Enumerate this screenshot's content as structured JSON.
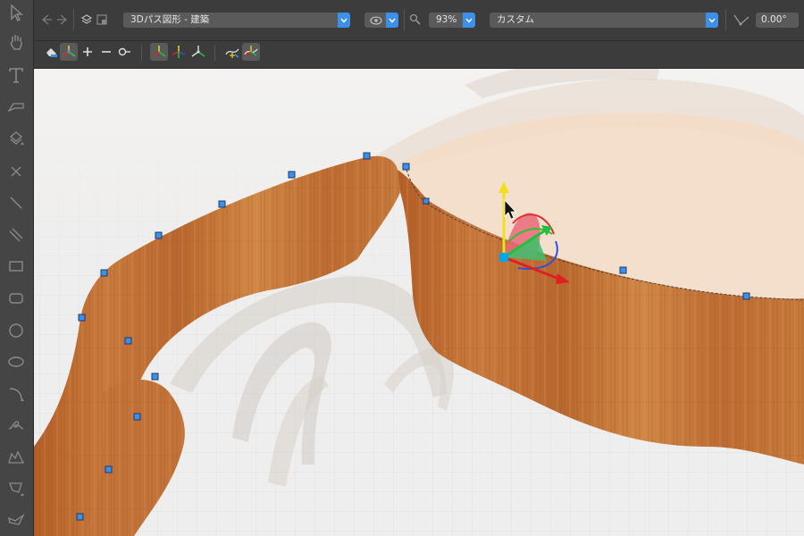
{
  "toolbar": {
    "shape_select": {
      "value": "3Dパス図形 - 建築"
    },
    "view_select": {
      "value": ""
    },
    "zoom": {
      "value": "93%"
    },
    "material_select": {
      "value": "カスタム"
    },
    "angle": {
      "value": "0.00°"
    }
  },
  "colors": {
    "accent": "#3d8fe8",
    "handle": "#3d8fe8",
    "wood": "#c8743a",
    "axis_x": "#e02020",
    "axis_y": "#f0e020",
    "axis_z": "#20c040",
    "rotate_ring_red": "#e03030",
    "rotate_ring_green": "#30c030",
    "rotate_ring_blue": "#3050e0"
  }
}
